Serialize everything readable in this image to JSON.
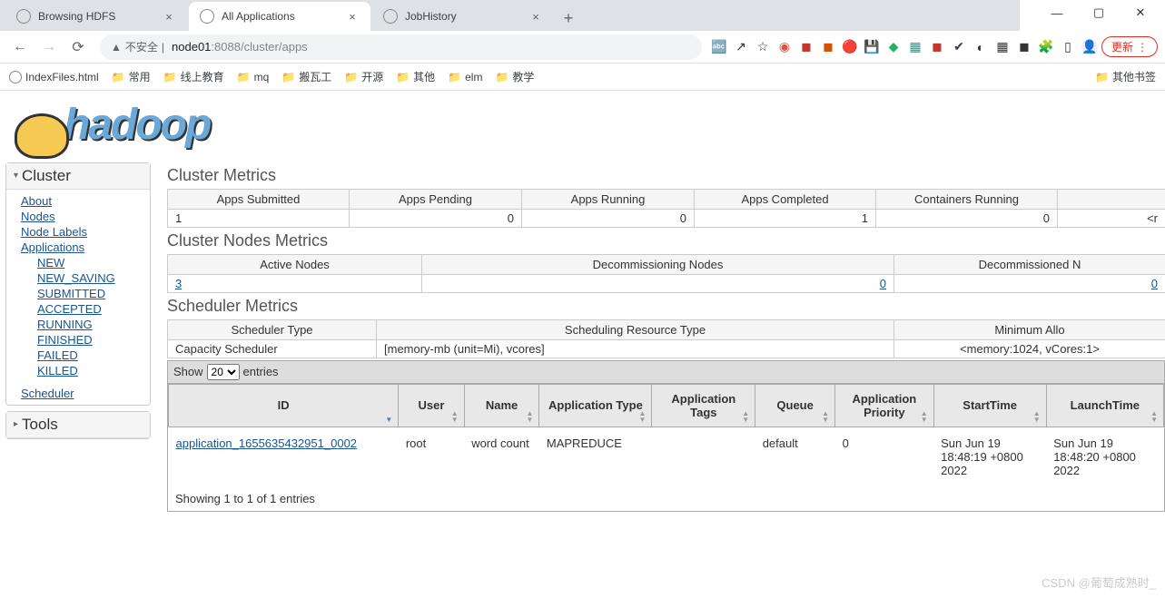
{
  "browser": {
    "tabs": [
      {
        "title": "Browsing HDFS"
      },
      {
        "title": "All Applications"
      },
      {
        "title": "JobHistory"
      }
    ],
    "active_tab": 1,
    "url_insecure_label": "不安全",
    "url_host": "node01",
    "url_port": ":8088",
    "url_path": "/cluster/apps",
    "update_label": "更新",
    "bookmarks": [
      "IndexFiles.html",
      "常用",
      "线上教育",
      "mq",
      "搬瓦工",
      "开源",
      "其他",
      "elm",
      "教学"
    ],
    "other_bookmarks": "其他书签"
  },
  "logo_text": "hadoop",
  "sidebar": {
    "cluster": {
      "header": "Cluster",
      "links": [
        "About",
        "Nodes",
        "Node Labels",
        "Applications"
      ],
      "sub": [
        "NEW",
        "NEW_SAVING",
        "SUBMITTED",
        "ACCEPTED",
        "RUNNING",
        "FINISHED",
        "FAILED",
        "KILLED"
      ],
      "scheduler": "Scheduler"
    },
    "tools": {
      "header": "Tools"
    }
  },
  "cluster_metrics": {
    "title": "Cluster Metrics",
    "headers": [
      "Apps Submitted",
      "Apps Pending",
      "Apps Running",
      "Apps Completed",
      "Containers Running",
      ""
    ],
    "values": [
      "1",
      "0",
      "0",
      "1",
      "0",
      "<r"
    ]
  },
  "nodes_metrics": {
    "title": "Cluster Nodes Metrics",
    "headers": [
      "Active Nodes",
      "Decommissioning Nodes",
      "Decommissioned N"
    ],
    "values": [
      "3",
      "0",
      "0"
    ]
  },
  "scheduler_metrics": {
    "title": "Scheduler Metrics",
    "headers": [
      "Scheduler Type",
      "Scheduling Resource Type",
      "Minimum Allo"
    ],
    "values": [
      "Capacity Scheduler",
      "[memory-mb (unit=Mi), vcores]",
      "<memory:1024, vCores:1>"
    ]
  },
  "apps_table": {
    "show_label": "Show",
    "show_value": "20",
    "entries_label": "entries",
    "headers": [
      "ID",
      "User",
      "Name",
      "Application Type",
      "Application Tags",
      "Queue",
      "Application Priority",
      "StartTime",
      "LaunchTime"
    ],
    "row": {
      "id": "application_1655635432951_0002",
      "user": "root",
      "name": "word count",
      "type": "MAPREDUCE",
      "tags": "",
      "queue": "default",
      "priority": "0",
      "start": "Sun Jun 19 18:48:19 +0800 2022",
      "launch": "Sun Jun 19 18:48:20 +0800 2022"
    },
    "footer": "Showing 1 to 1 of 1 entries"
  },
  "watermark": "CSDN @葡萄成熟时_"
}
